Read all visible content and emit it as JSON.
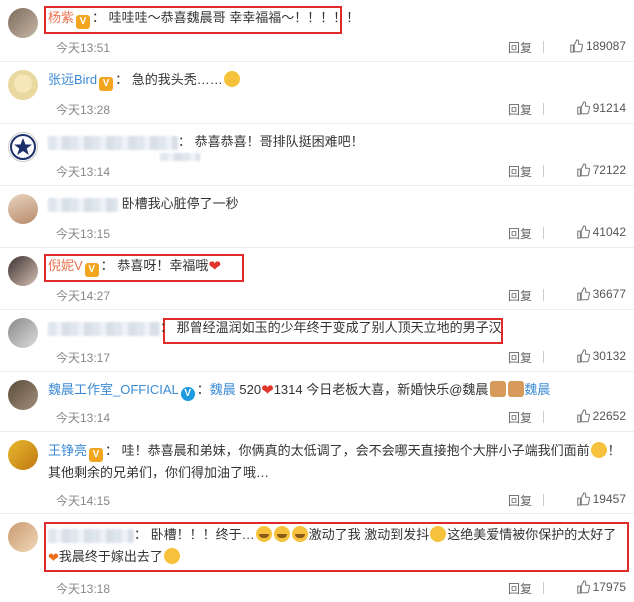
{
  "reply_label": "回复",
  "comments": [
    {
      "user": "杨紫",
      "colon": "：",
      "text": "哇哇哇～恭喜魏晨哥 幸幸福福～！！！！！",
      "time": "今天13:51",
      "likes": "189087"
    },
    {
      "user": "张远Bird",
      "colon": "：",
      "text": "急的我头秃……",
      "time": "今天13:28",
      "likes": "91214"
    },
    {
      "user": "",
      "colon": "：",
      "text": "恭喜恭喜！哥排队挺困难吧！",
      "time": "今天13:14",
      "likes": "72122"
    },
    {
      "user": "",
      "colon": "",
      "text": "卧槽我心脏停了一秒",
      "time": "今天13:15",
      "likes": "41042"
    },
    {
      "user": "倪妮V",
      "colon": "：",
      "text": "恭喜呀！幸福哦",
      "time": "今天14:27",
      "likes": "36677"
    },
    {
      "user": "",
      "colon": "：",
      "text": "那曾经温润如玉的少年终于变成了别人顶天立地的男子汉",
      "time": "今天13:17",
      "likes": "30132"
    },
    {
      "user": "魏晨工作室_OFFICIAL",
      "colon": "：",
      "mention": "魏晨",
      "text": "520",
      "text2": "1314 今日老板大喜，新婚快乐@魏晨",
      "mention2": "魏晨",
      "time": "今天13:14",
      "likes": "22652"
    },
    {
      "user": "王铮亮",
      "colon": "：",
      "text": "哇！恭喜晨和弟妹，你俩真的太低调了，会不会哪天直接抱个大胖小子端我们面前",
      "text2": "！其他剩余的兄弟们，你们得加油了哦…",
      "time": "今天14:15",
      "likes": "19457"
    },
    {
      "user": "",
      "colon": "：",
      "text": "卧槽！！！终于…",
      "text2": "激动了我 激动到发抖",
      "text3": "这绝美爱情被你保护的太好了",
      "text4": "我晨终于嫁出去了",
      "time": "今天13:18",
      "likes": "17975"
    }
  ],
  "colors": {
    "highlight": "#e02a2a",
    "username": "#eb7350",
    "link": "#3b8ad6"
  }
}
